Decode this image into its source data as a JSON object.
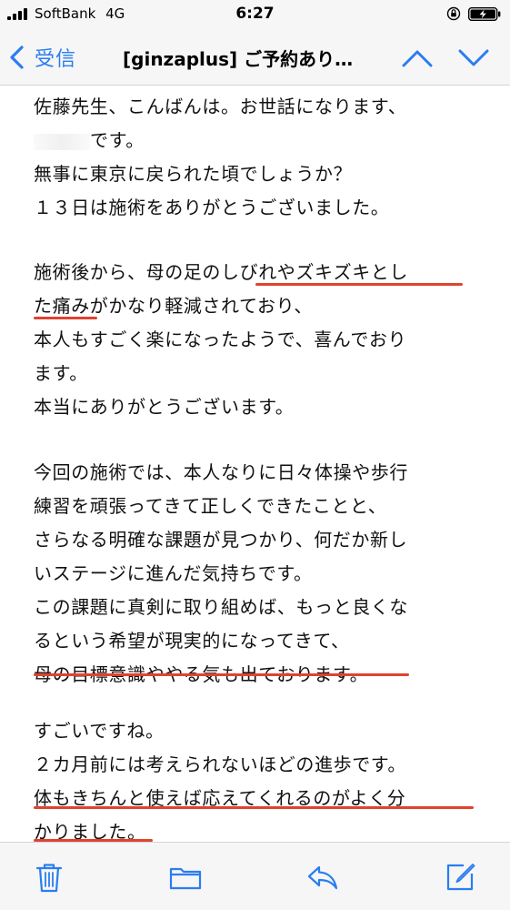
{
  "status_bar": {
    "carrier": "SoftBank",
    "network": "4G",
    "time": "6:27"
  },
  "nav": {
    "back_label": "受信",
    "title": "[ginzaplus] ご予約あり…"
  },
  "message": {
    "paragraphs": [
      [
        "佐藤先生、こんばんは。お世話になります、",
        "です。",
        "無事に東京に戻られた頃でしょうか？",
        "１３日は施術をありがとうございました。"
      ],
      [
        "施術後から、母の足のしびれやズキズキとし",
        "た痛みがかなり軽減されており、",
        "本人もすごく楽になったようで、喜んでおり",
        "ます。",
        "本当にありがとうございます。"
      ],
      [
        "今回の施術では、本人なりに日々体操や歩行",
        "練習を頑張ってきて正しくできたことと、",
        "さらなる明確な課題が見つかり、何だか新し",
        "いステージに進んだ気持ちです。",
        "この課題に真剣に取り組めば、もっと良くな",
        "るという希望が現実的になってきて、",
        "母の目標意識ややる気も出ております。"
      ],
      [
        "すごいですね。",
        "２カ月前には考えられないほどの進歩です。",
        "体もきちんと使えば応えてくれるのがよく分",
        "かりました。"
      ]
    ]
  },
  "colors": {
    "accent": "#2a7df0",
    "underline": "#e0432e",
    "bar_background": "#f6f6f7"
  },
  "icons": {
    "back": "chevron-left-icon",
    "up": "chevron-up-icon",
    "down": "chevron-down-icon",
    "trash": "trash-icon",
    "folder": "folder-icon",
    "reply": "reply-icon",
    "compose": "compose-icon"
  }
}
